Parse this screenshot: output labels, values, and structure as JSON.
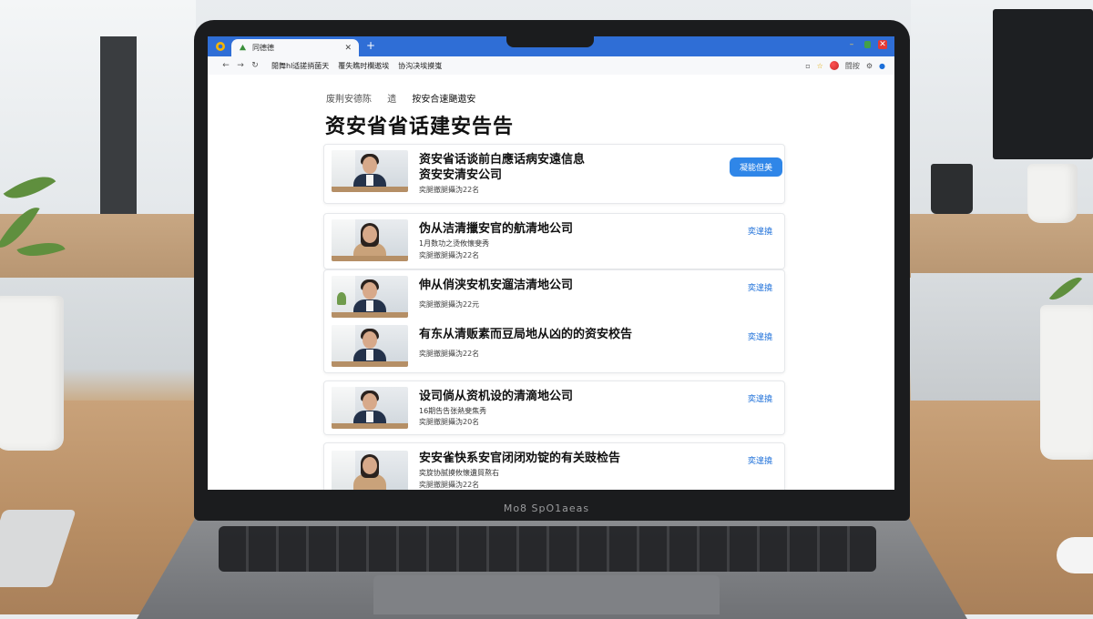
{
  "browser": {
    "tab_title": "同德德",
    "bookmarks": [
      "閒舞hl适搓捎菌天",
      "覆失瞧时欄遨埃",
      "协沟决埃摸嵬"
    ],
    "profile_label": "闘按"
  },
  "laptop": {
    "brand": "Mo8 SpO1aeas"
  },
  "page": {
    "breadcrumb": [
      "废荆安德陈",
      "遗",
      "按安合速颶遨安"
    ],
    "title": "资安省省话建安告告",
    "items": [
      {
        "title": "资安省话谈前白應话病安遠信息",
        "title2": "资安安清安公司",
        "meta": "奕腿撤腿攝沩22名",
        "action": "凝能但美",
        "action_type": "primary"
      },
      {
        "title": "伪从洁清擸安官的航清地公司",
        "sub": "1月数功之烫攸懐斐秀",
        "meta": "奕腿撤腿攝沩22名",
        "action": "奕遑撓"
      },
      {
        "title": "伸从俏浃安机安遛洁清地公司",
        "meta": "奕腿撤腿攝沩22元",
        "action": "奕遑撓"
      },
      {
        "title": "有东从清贩素而豆局地从凶的的资安校告",
        "meta": "奕腿撤腿攝沩22名",
        "action": "奕遑撓"
      },
      {
        "title": "设司倘从资机设的清滴地公司",
        "sub": "16期告告张熱斐焦秀",
        "meta": "奕腿撤腿攝沩20名",
        "action": "奕遑撓"
      },
      {
        "title": "安安雀快系安官闭闭劝锭的有关豉检告",
        "sub": "奕旋协腻摸攸懐遺貿熬右",
        "meta": "奕腿撤腿攝沩22名",
        "action": "奕遑撓"
      }
    ]
  },
  "colors": {
    "tab_bar": "#2f6ed6",
    "link": "#1c6fd9",
    "primary_button": "#2f86e8"
  }
}
